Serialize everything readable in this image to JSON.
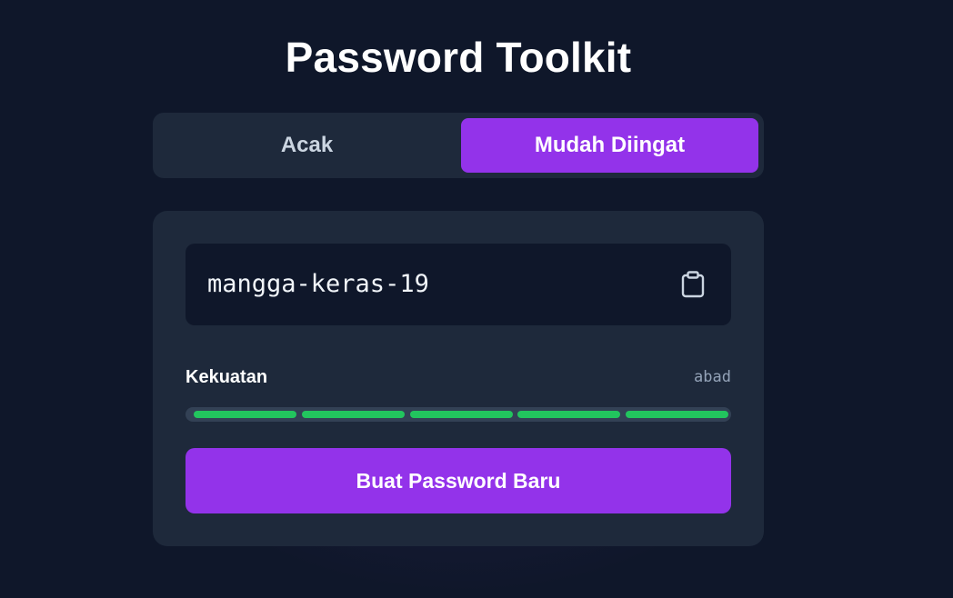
{
  "header": {
    "title": "Password Toolkit"
  },
  "tabs": [
    {
      "label": "Acak",
      "active": false
    },
    {
      "label": "Mudah Diingat",
      "active": true
    }
  ],
  "password": {
    "value": "mangga-keras-19",
    "copy_icon": "clipboard-icon"
  },
  "strength": {
    "label": "Kekuatan",
    "value": "abad",
    "level": 5,
    "max": 5,
    "color": "#22c55e"
  },
  "actions": {
    "generate_label": "Buat Password Baru"
  },
  "colors": {
    "accent": "#9333ea",
    "background": "#0f172a",
    "card": "#1e293b"
  }
}
